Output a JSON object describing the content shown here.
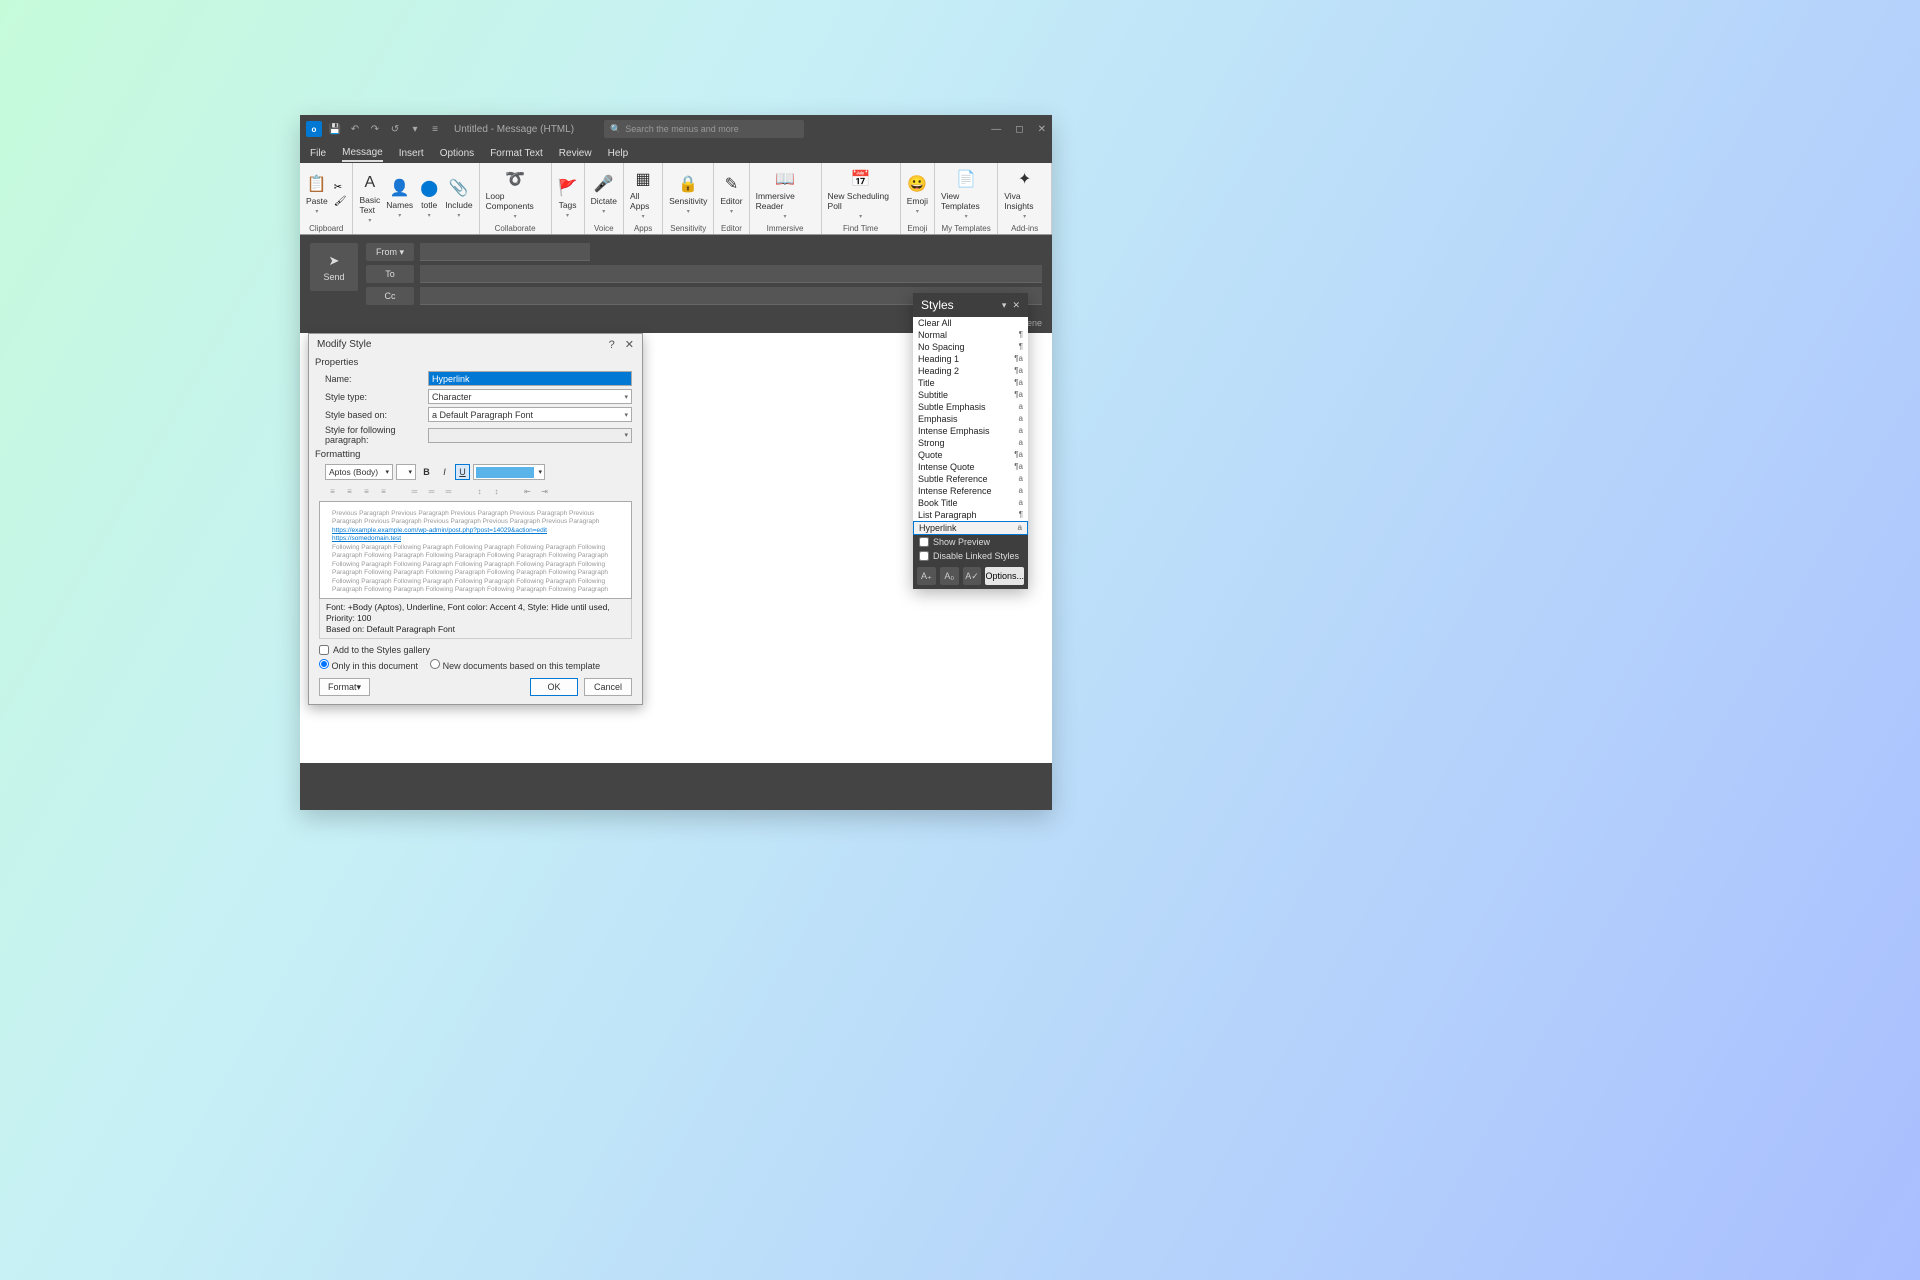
{
  "titlebar": {
    "title": "Untitled - Message (HTML)",
    "search_placeholder": "Search the menus and more"
  },
  "tabs": [
    "File",
    "Message",
    "Insert",
    "Options",
    "Format Text",
    "Review",
    "Help"
  ],
  "active_tab": "Message",
  "ribbon": [
    {
      "group": "Clipboard",
      "items": [
        {
          "label": "Paste",
          "icon": "📋"
        }
      ],
      "side": [
        {
          "icon": "✂"
        },
        {
          "icon": "🖌"
        }
      ]
    },
    {
      "group": "",
      "items": [
        {
          "label": "Basic Text",
          "icon": "A"
        },
        {
          "label": "Names",
          "icon": "👤"
        },
        {
          "label": "totle",
          "icon": "⬤",
          "blue": true
        },
        {
          "label": "Include",
          "icon": "📎"
        }
      ]
    },
    {
      "group": "Collaborate",
      "items": [
        {
          "label": "Loop Components",
          "icon": "➰"
        }
      ]
    },
    {
      "group": "",
      "items": [
        {
          "label": "Tags",
          "icon": "🚩"
        }
      ]
    },
    {
      "group": "Voice",
      "items": [
        {
          "label": "Dictate",
          "icon": "🎤"
        }
      ]
    },
    {
      "group": "Apps",
      "items": [
        {
          "label": "All Apps",
          "icon": "▦"
        }
      ]
    },
    {
      "group": "Sensitivity",
      "items": [
        {
          "label": "Sensitivity",
          "icon": "🔒"
        }
      ]
    },
    {
      "group": "Editor",
      "items": [
        {
          "label": "Editor",
          "icon": "✎"
        }
      ]
    },
    {
      "group": "Immersive",
      "items": [
        {
          "label": "Immersive Reader",
          "icon": "📖"
        }
      ]
    },
    {
      "group": "Find Time",
      "items": [
        {
          "label": "New Scheduling Poll",
          "icon": "📅"
        }
      ]
    },
    {
      "group": "Emoji",
      "items": [
        {
          "label": "Emoji",
          "icon": "😀"
        }
      ]
    },
    {
      "group": "My Templates",
      "items": [
        {
          "label": "View Templates",
          "icon": "📄"
        }
      ]
    },
    {
      "group": "Add-ins",
      "items": [
        {
          "label": "Viva Insights",
          "icon": "✦"
        }
      ]
    }
  ],
  "msg": {
    "send": "Send",
    "from": "From",
    "to": "To",
    "cc": "Cc",
    "sensitivity_indicator": "⛨ Gene"
  },
  "styles_pane": {
    "title": "Styles",
    "items": [
      {
        "name": "Clear All",
        "ind": ""
      },
      {
        "name": "Normal",
        "ind": "¶"
      },
      {
        "name": "No Spacing",
        "ind": "¶"
      },
      {
        "name": "Heading 1",
        "ind": "¶a"
      },
      {
        "name": "Heading 2",
        "ind": "¶a"
      },
      {
        "name": "Title",
        "ind": "¶a"
      },
      {
        "name": "Subtitle",
        "ind": "¶a"
      },
      {
        "name": "Subtle Emphasis",
        "ind": "a"
      },
      {
        "name": "Emphasis",
        "ind": "a"
      },
      {
        "name": "Intense Emphasis",
        "ind": "a"
      },
      {
        "name": "Strong",
        "ind": "a"
      },
      {
        "name": "Quote",
        "ind": "¶a"
      },
      {
        "name": "Intense Quote",
        "ind": "¶a"
      },
      {
        "name": "Subtle Reference",
        "ind": "a"
      },
      {
        "name": "Intense Reference",
        "ind": "a"
      },
      {
        "name": "Book Title",
        "ind": "a"
      },
      {
        "name": "List Paragraph",
        "ind": "¶"
      },
      {
        "name": "Hyperlink",
        "ind": "a",
        "selected": true
      }
    ],
    "show_preview": "Show Preview",
    "disable_linked": "Disable Linked Styles",
    "options": "Options..."
  },
  "dialog": {
    "title": "Modify Style",
    "sections": {
      "properties": "Properties",
      "formatting": "Formatting"
    },
    "labels": {
      "name": "Name:",
      "style_type": "Style type:",
      "based_on": "Style based on:",
      "following": "Style for following paragraph:"
    },
    "values": {
      "name": "Hyperlink",
      "style_type": "Character",
      "based_on": "a Default Paragraph Font",
      "following": "",
      "font": "Aptos (Body)"
    },
    "color": "#5ab4ea",
    "preview_prev": "Previous Paragraph Previous Paragraph Previous Paragraph Previous Paragraph Previous Paragraph Previous Paragraph Previous Paragraph Previous Paragraph Previous Paragraph",
    "preview_link": "https://example.example.com/wp-admin/post.php?post=14029&action=edit",
    "preview_link2": "https://somedomain.test",
    "preview_next": "Following Paragraph Following Paragraph Following Paragraph Following Paragraph Following Paragraph Following Paragraph Following Paragraph Following Paragraph Following Paragraph Following Paragraph Following Paragraph Following Paragraph Following Paragraph Following Paragraph Following Paragraph Following Paragraph Following Paragraph Following Paragraph Following Paragraph Following Paragraph Following Paragraph Following Paragraph Following Paragraph Following Paragraph Following Paragraph Following Paragraph Following Paragraph",
    "desc": "Font: +Body (Aptos), Underline, Font color: Accent 4, Style: Hide until used, Priority: 100\n  Based on: Default Paragraph Font",
    "add_to_gallery": "Add to the Styles gallery",
    "only_in": "Only in this document",
    "new_docs": "New documents based on this template",
    "format": "Format",
    "ok": "OK",
    "cancel": "Cancel"
  }
}
